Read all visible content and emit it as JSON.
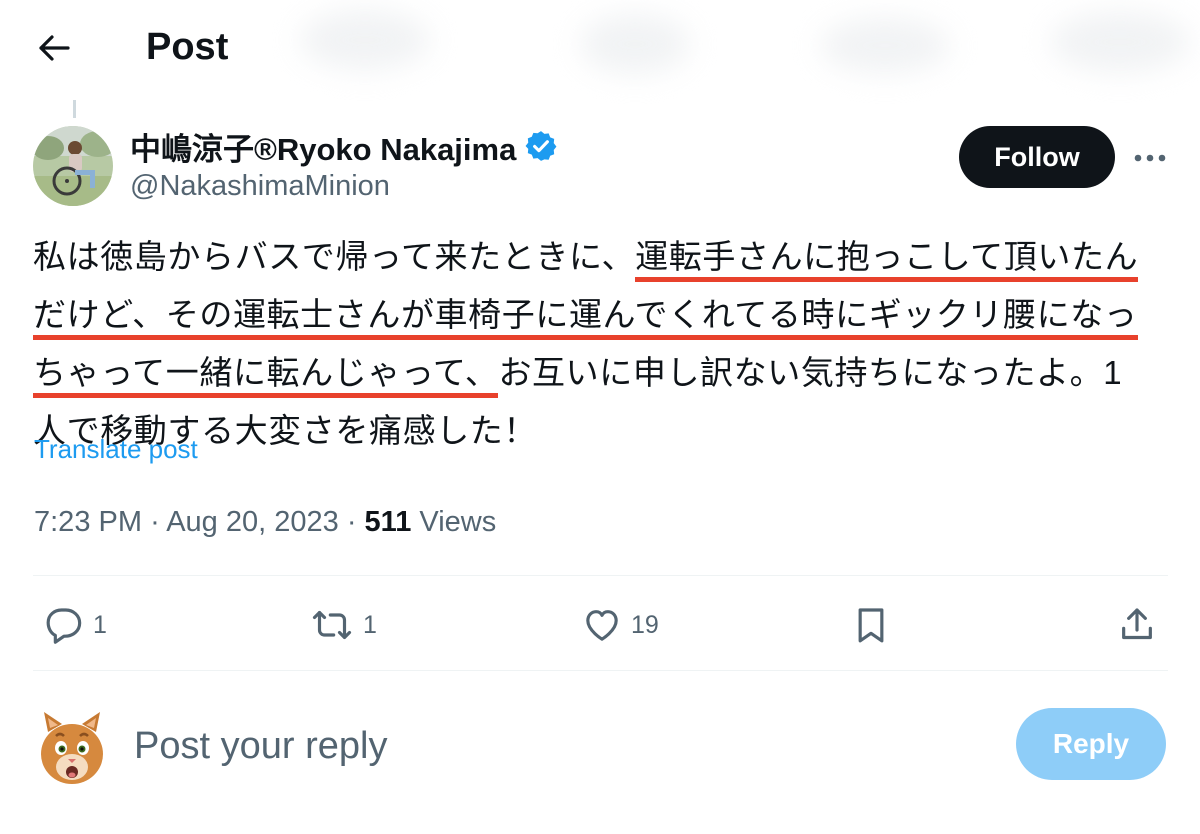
{
  "header": {
    "title": "Post"
  },
  "author": {
    "display_name": "中嶋涼子®Ryoko Nakajima",
    "handle": "@NakashimaMinion",
    "verified": true
  },
  "follow_label": "Follow",
  "tweet": {
    "lines": [
      [
        {
          "text": "私は徳島からバスで帰って来たときに、",
          "highlight": false
        },
        {
          "text": "運転手さんに抱っこして頂いたん",
          "highlight": true
        }
      ],
      [
        {
          "text": "だけど、その運転士さんが車椅子に運んでくれてる時にギックリ腰になっ",
          "highlight": true
        }
      ],
      [
        {
          "text": "ちゃって一緒に転んじゃって、",
          "highlight": true
        },
        {
          "text": "お互いに申し訳ない気持ちになったよ。1",
          "highlight": false
        }
      ],
      [
        {
          "text": "人で移動する大変さを痛感した！",
          "highlight": false
        }
      ]
    ],
    "highlight_color": "#e8412c"
  },
  "translate_label": "Translate post",
  "meta": {
    "time": "7:23 PM",
    "date": "Aug 20, 2023",
    "separator": "·",
    "views_count": "511",
    "views_label": "Views"
  },
  "actions": {
    "reply_count": "1",
    "repost_count": "1",
    "like_count": "19"
  },
  "reply_box": {
    "placeholder": "Post your reply",
    "button_label": "Reply"
  },
  "colors": {
    "primary_text": "#0f1419",
    "secondary_text": "#536471",
    "link": "#1d9bf0",
    "verified": "#1d9bf0",
    "reply_button_disabled": "#8ecdf8"
  }
}
